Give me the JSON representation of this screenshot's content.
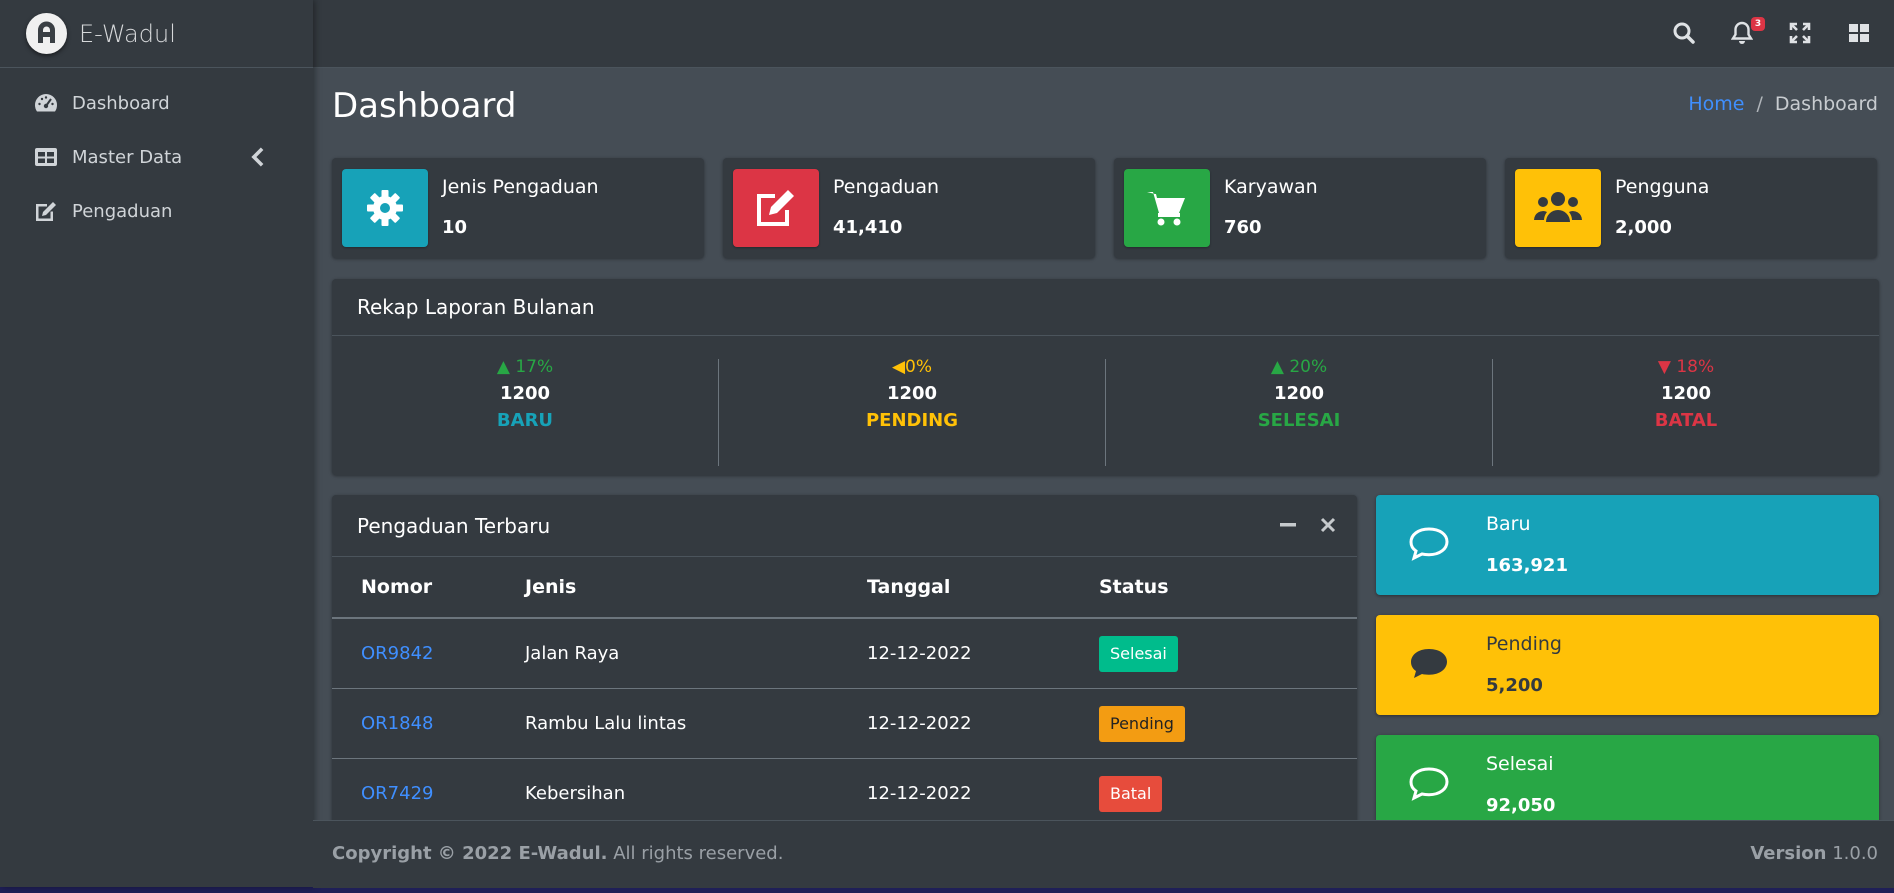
{
  "app": {
    "brand": "E-Wadul"
  },
  "colors": {
    "info": "#17a2b8",
    "danger": "#dc3545",
    "success": "#28a745",
    "warning": "#ffc107",
    "link": "#3f8fff",
    "sidebar_bg": "#343a40",
    "content_bg": "#454d55"
  },
  "sidebar": {
    "items": [
      {
        "label": "Dashboard",
        "icon": "tachometer-icon"
      },
      {
        "label": "Master Data",
        "icon": "table-icon",
        "has_children": true
      },
      {
        "label": "Pengaduan",
        "icon": "edit-icon"
      }
    ]
  },
  "topbar": {
    "notification_count": "3",
    "icons": [
      "search-icon",
      "bell-icon",
      "fullscreen-icon",
      "grid-icon"
    ]
  },
  "page": {
    "title": "Dashboard"
  },
  "breadcrumb": {
    "home": "Home",
    "sep": "/",
    "current": "Dashboard"
  },
  "info_boxes": [
    {
      "label": "Jenis Pengaduan",
      "value": "10",
      "icon": "gear-icon",
      "color": "#17a2b8"
    },
    {
      "label": "Pengaduan",
      "value": "41,410",
      "icon": "edit-icon",
      "color": "#dc3545"
    },
    {
      "label": "Karyawan",
      "value": "760",
      "icon": "cart-icon",
      "color": "#28a745"
    },
    {
      "label": "Pengguna",
      "value": "2,000",
      "icon": "users-icon",
      "color": "#ffc107"
    }
  ],
  "rekap": {
    "title": "Rekap Laporan Bulanan",
    "items": [
      {
        "pct": "17%",
        "amount": "1200",
        "label": "BARU",
        "trend": "up"
      },
      {
        "pct": "0%",
        "amount": "1200",
        "label": "PENDING",
        "trend": "left"
      },
      {
        "pct": "20%",
        "amount": "1200",
        "label": "SELESAI",
        "trend": "up"
      },
      {
        "pct": "18%",
        "amount": "1200",
        "label": "BATAL",
        "trend": "down"
      }
    ]
  },
  "latest": {
    "title": "Pengaduan Terbaru",
    "columns": [
      "Nomor",
      "Jenis",
      "Tanggal",
      "Status"
    ],
    "rows": [
      {
        "nomor": "OR9842",
        "jenis": "Jalan Raya",
        "tanggal": "12-12-2022",
        "status": "Selesai"
      },
      {
        "nomor": "OR1848",
        "jenis": "Rambu Lalu lintas",
        "tanggal": "12-12-2022",
        "status": "Pending"
      },
      {
        "nomor": "OR7429",
        "jenis": "Kebersihan",
        "tanggal": "12-12-2022",
        "status": "Batal"
      }
    ]
  },
  "status_boxes": [
    {
      "label": "Baru",
      "value": "163,921",
      "icon": "comment-icon"
    },
    {
      "label": "Pending",
      "value": "5,200",
      "icon": "comment-icon"
    },
    {
      "label": "Selesai",
      "value": "92,050",
      "icon": "comment-icon"
    }
  ],
  "footer": {
    "copyright": "Copyright © 2022 E-Wadul.",
    "rights": "All rights reserved.",
    "version_label": "Version",
    "version": "1.0.0"
  }
}
